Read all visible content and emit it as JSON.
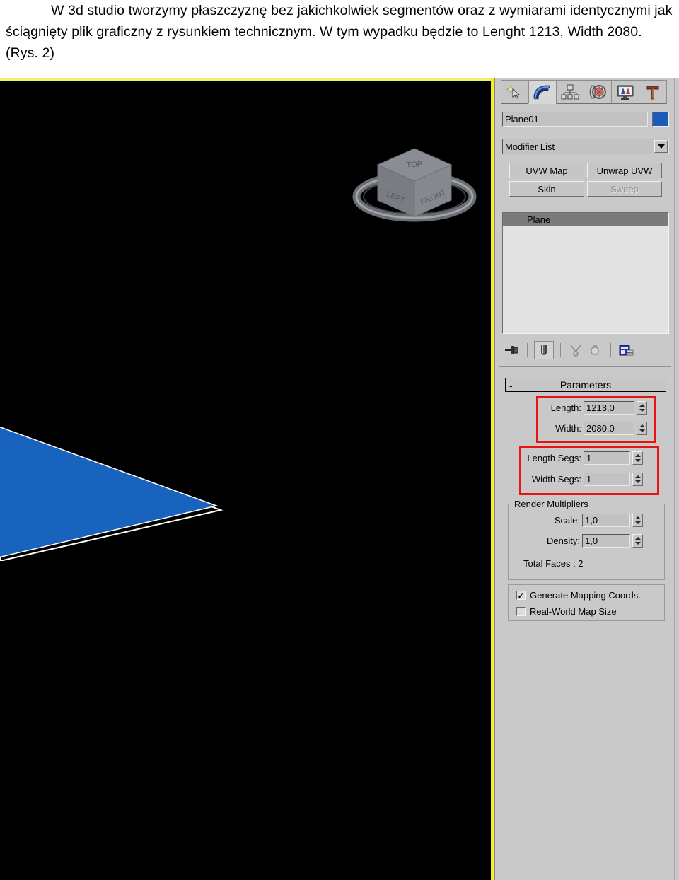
{
  "caption": {
    "text": "W 3d studio tworzymy płaszczyznę bez jakichkolwiek segmentów oraz z wymiarami identycznymi jak ściągnięty plik graficzny z rysunkiem technicznym. W tym wypadku będzie to Lenght 1213, Width 2080. (Rys. 2)"
  },
  "viewport": {
    "background_color": "#000000",
    "active_border_color": "#f2ef6a",
    "object_fill_color": "#1763bd",
    "object_outline_color": "#ffffff",
    "viewcube": {
      "top_label": "TOP",
      "left_label": "LEFT",
      "front_label": "FRONT"
    }
  },
  "command_panel": {
    "tabs": [
      {
        "name": "create-tab",
        "icon": "create-star-cursor-icon",
        "active": false
      },
      {
        "name": "modify-tab",
        "icon": "modify-arc-icon",
        "active": true
      },
      {
        "name": "hierarchy-tab",
        "icon": "hierarchy-nodes-icon",
        "active": false
      },
      {
        "name": "motion-tab",
        "icon": "motion-wheel-icon",
        "active": false
      },
      {
        "name": "display-tab",
        "icon": "display-monitor-icon",
        "active": false
      },
      {
        "name": "utilities-tab",
        "icon": "utilities-hammer-icon",
        "active": false
      }
    ],
    "object_name": "Plane01",
    "object_color": "#1b5cb8",
    "modifier_list_label": "Modifier List",
    "modifier_buttons": [
      {
        "label": "UVW Map",
        "disabled": false
      },
      {
        "label": "Unwrap UVW",
        "disabled": false
      },
      {
        "label": "Skin",
        "disabled": false
      },
      {
        "label": "Sweep",
        "disabled": true
      }
    ],
    "stack": {
      "entries": [
        "Plane"
      ]
    },
    "stack_toolbar": [
      {
        "name": "pin-stack-icon"
      },
      {
        "name": "show-end-result-icon"
      },
      {
        "name": "make-unique-icon"
      },
      {
        "name": "remove-modifier-icon"
      },
      {
        "name": "configure-modifier-sets-icon"
      }
    ],
    "parameters": {
      "rollout_title": "Parameters",
      "rollout_toggle": "-",
      "fields": [
        {
          "label": "Length:",
          "value": "1213,0",
          "highlighted": true
        },
        {
          "label": "Width:",
          "value": "2080,0",
          "highlighted": true
        },
        {
          "label": "Length Segs:",
          "value": "1",
          "highlighted": true
        },
        {
          "label": "Width Segs:",
          "value": "1",
          "highlighted": true
        }
      ],
      "render_multipliers": {
        "group_label": "Render Multipliers",
        "scale_label": "Scale:",
        "scale_value": "1,0",
        "density_label": "Density:",
        "density_value": "1,0",
        "total_faces": "Total Faces : 2"
      },
      "checkboxes": [
        {
          "label": "Generate Mapping Coords.",
          "checked": true
        },
        {
          "label": "Real-World Map Size",
          "checked": false
        }
      ],
      "highlight_color": "#e81414"
    }
  }
}
